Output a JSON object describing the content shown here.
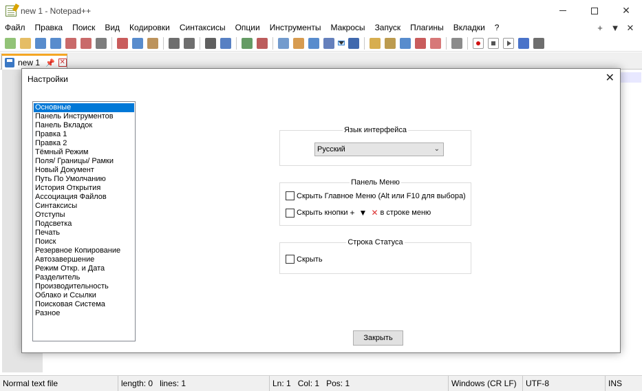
{
  "window": {
    "title": "new 1 - Notepad++"
  },
  "menu": {
    "items": [
      "Файл",
      "Правка",
      "Поиск",
      "Вид",
      "Кодировки",
      "Синтаксисы",
      "Опции",
      "Инструменты",
      "Макросы",
      "Запуск",
      "Плагины",
      "Вкладки",
      "?"
    ],
    "right": [
      "+",
      "▼",
      "✕"
    ]
  },
  "toolbar": {
    "icons": [
      "new-file-icon",
      "open-file-icon",
      "save-icon",
      "save-all-icon",
      "close-icon",
      "close-all-icon",
      "print-icon",
      "|",
      "cut-icon",
      "copy-icon",
      "paste-icon",
      "|",
      "undo-icon",
      "redo-icon",
      "|",
      "find-icon",
      "replace-icon",
      "|",
      "zoom-in-icon",
      "zoom-out-icon",
      "|",
      "sync-vertical-icon",
      "sync-horizontal-icon",
      "word-wrap-icon",
      "show-all-chars-icon",
      "dropdown-icon",
      "indent-guide-icon",
      "|",
      "udl-icon",
      "doc-map-icon",
      "doc-list-icon",
      "function-list-icon",
      "folder-workspace-icon",
      "|",
      "monitoring-icon",
      "|",
      "record-macro-icon",
      "stop-record-icon",
      "play-macro-icon",
      "run-macro-multiple-icon",
      "save-macro-icon"
    ],
    "active_index": 25
  },
  "tab": {
    "label": "new 1",
    "pin": "📌",
    "close": "✕"
  },
  "status": {
    "file_type": "Normal text file",
    "length": "length: 0",
    "lines": "lines: 1",
    "ln": "Ln: 1",
    "col": "Col: 1",
    "pos": "Pos: 1",
    "eol": "Windows (CR LF)",
    "encoding": "UTF-8",
    "mode": "INS"
  },
  "dialog": {
    "title": "Настройки",
    "close": "✕",
    "categories": [
      "Основные",
      "Панель Инструментов",
      "Панель Вкладок",
      "Правка 1",
      "Правка 2",
      "Тёмный Режим",
      "Поля/ Границы/ Рамки",
      "Новый Документ",
      "Путь По Умолчанию",
      "История Открытия",
      "Ассоциация Файлов",
      "Синтаксисы",
      "Отступы",
      "Подсветка",
      "Печать",
      "Поиск",
      "Резервное Копирование",
      "Автозавершение",
      "Режим Откр. и Дата",
      "Разделитель",
      "Производительность",
      "Облако и Ссылки",
      "Поисковая Система",
      "Разное"
    ],
    "selected_index": 0,
    "language_group": {
      "title": "Язык интерфейса",
      "value": "Русский"
    },
    "menu_group": {
      "title": "Панель Меню",
      "hide_menu": "Скрыть Главное Меню (Alt или F10 для выбора)",
      "hide_buttons": "Скрыть кнопки",
      "plus": "+",
      "down": "▼",
      "x": "✕",
      "hide_buttons_suffix": "в строке меню"
    },
    "status_group": {
      "title": "Строка Статуса",
      "hide": "Скрыть"
    },
    "close_button": "Закрыть"
  }
}
